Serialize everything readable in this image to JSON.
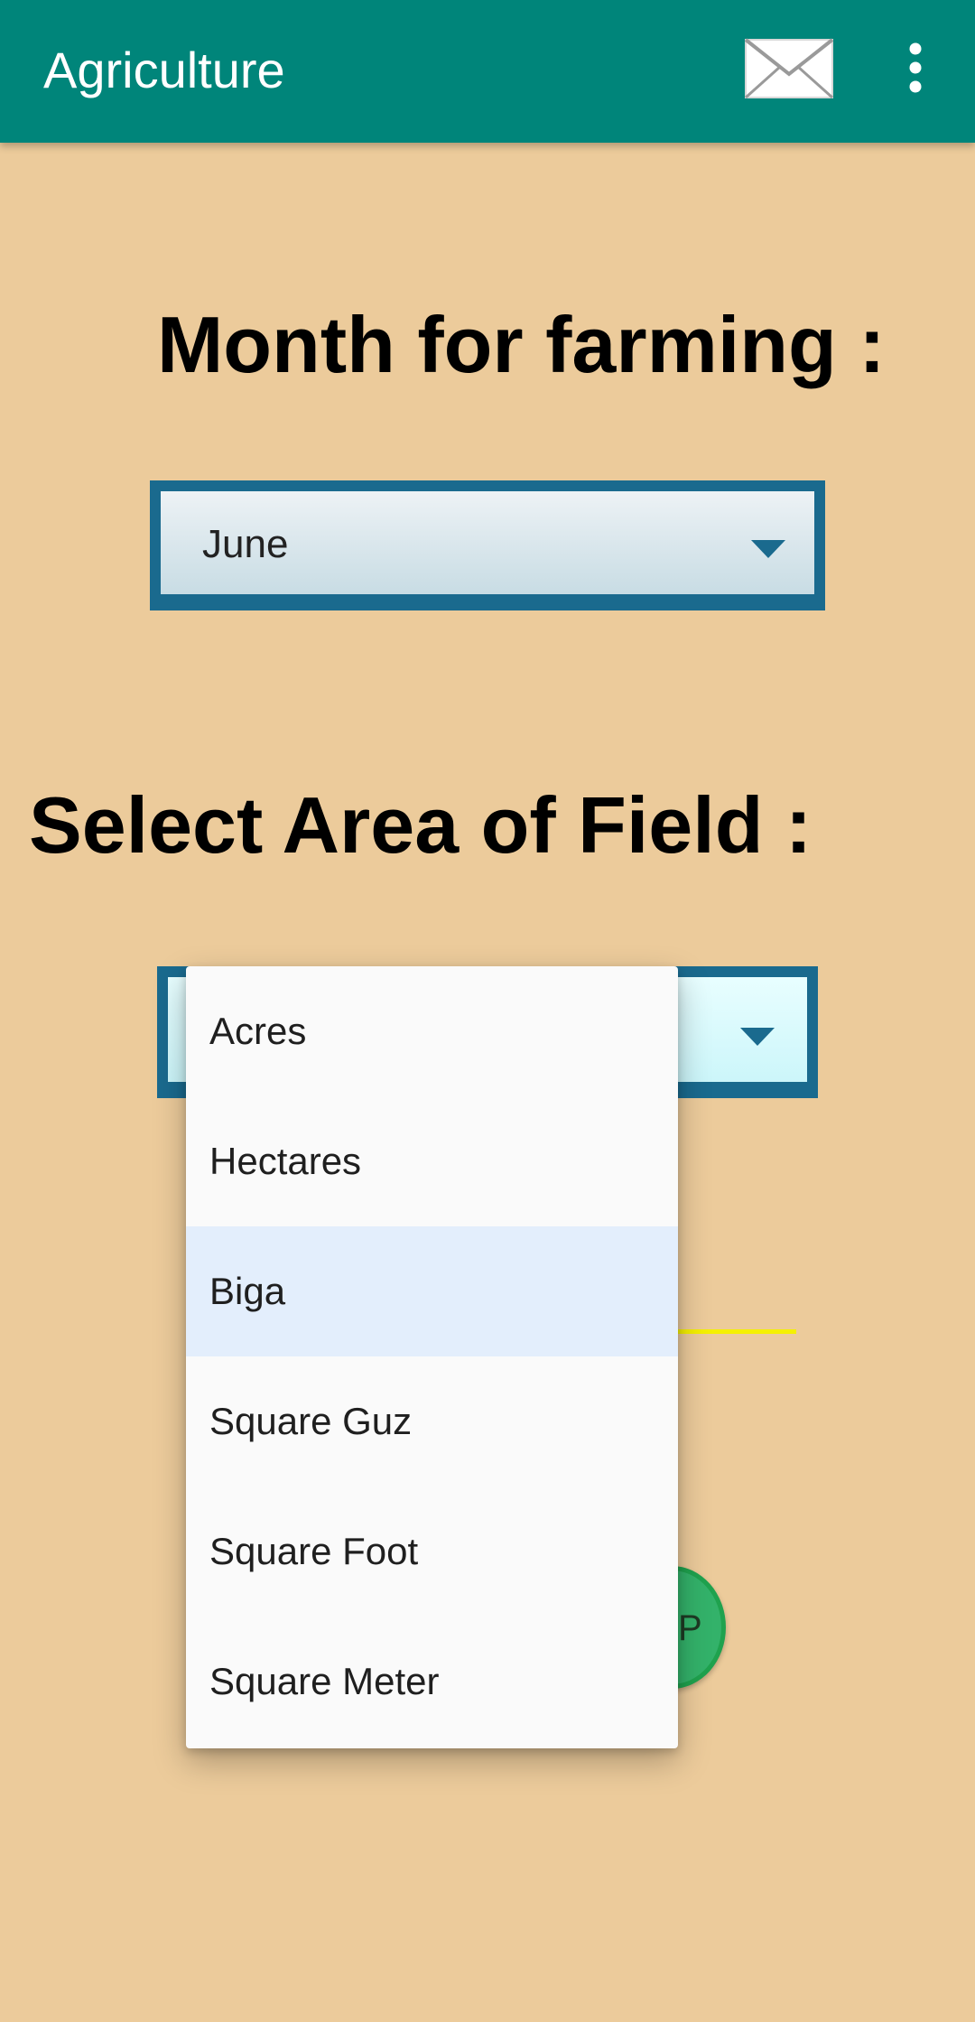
{
  "appbar": {
    "title": "Agriculture",
    "mail_icon": "mail-icon",
    "overflow_icon": "more-vert-icon",
    "background": "#00857A"
  },
  "month_section": {
    "heading": "Month for farming :",
    "selected": "June"
  },
  "area_section": {
    "heading": "Select Area of Field :"
  },
  "dropdown": {
    "options": [
      {
        "label": "Acres",
        "selected": false
      },
      {
        "label": "Hectares",
        "selected": false
      },
      {
        "label": "Biga",
        "selected": true
      },
      {
        "label": "Square Guz",
        "selected": false
      },
      {
        "label": "Square Foot",
        "selected": false
      },
      {
        "label": "Square Meter",
        "selected": false
      }
    ]
  },
  "fab": {
    "label_partial": "P"
  },
  "colors": {
    "page_background": "#ECCB9B",
    "spinner_border": "#1A6A8E",
    "selected_option": "#E3EEFC",
    "accent_line": "#F5F000",
    "fab": "#33B26A"
  }
}
